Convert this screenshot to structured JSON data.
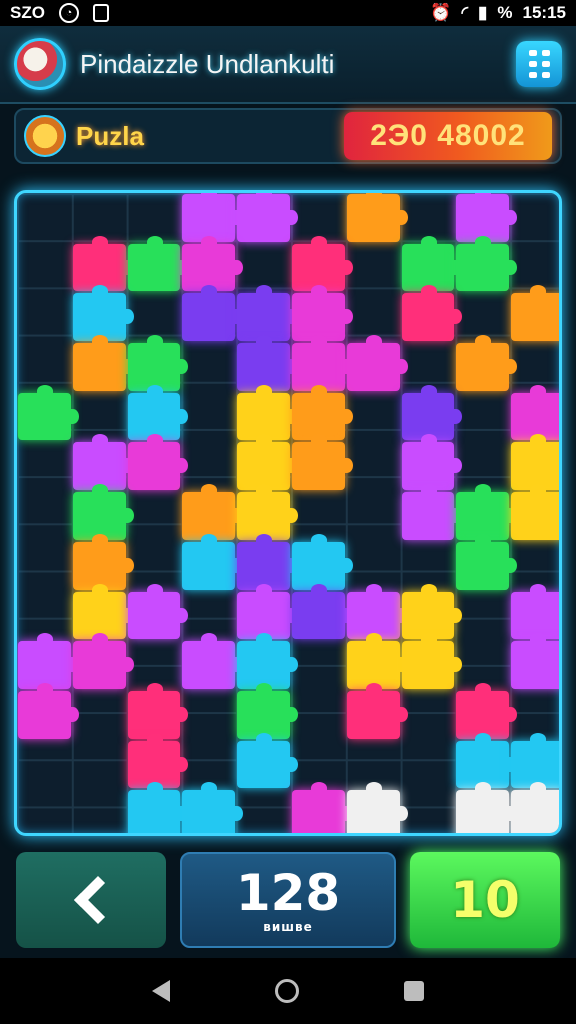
{
  "status_bar": {
    "left_text": "SZO",
    "time": "15:15",
    "battery": "%"
  },
  "header": {
    "title": "Pindaizzle Undlankulti",
    "logo_icon": "puzzle-mascot-icon",
    "menu_icon": "grid-menu-icon"
  },
  "level_bar": {
    "label": "Puzla",
    "score": "2Э0 48002"
  },
  "board": {
    "columns": 10,
    "rows": 13,
    "piece_colors": [
      "#c94cff",
      "#ff2f7a",
      "#28e05a",
      "#23c8f2",
      "#ff9c1a",
      "#ffd21a",
      "#e83ad8",
      "#7a3df0",
      "#f0f0f0"
    ]
  },
  "controls": {
    "back_icon": "chevron-left-icon",
    "moves_value": "128",
    "moves_label": "вишве",
    "level_value": "10"
  },
  "navbar": {
    "back_icon": "triangle-back-icon",
    "home_icon": "circle-home-icon",
    "recent_icon": "square-recent-icon"
  }
}
